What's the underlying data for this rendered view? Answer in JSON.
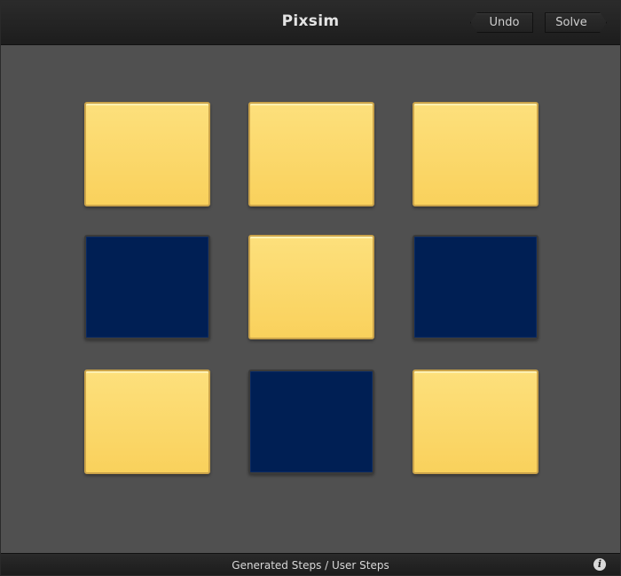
{
  "app": {
    "title": "Pixsim"
  },
  "toolbar": {
    "undo_label": "Undo",
    "solve_label": "Solve"
  },
  "board": {
    "rows": 3,
    "cols": 3,
    "colors": {
      "on": "#fbd86a",
      "off": "#001f54"
    },
    "tiles": [
      [
        "on",
        "on",
        "on"
      ],
      [
        "off",
        "on",
        "off"
      ],
      [
        "on",
        "off",
        "on"
      ]
    ]
  },
  "footer": {
    "status": "Generated Steps / User Steps",
    "info_icon": "info-icon",
    "info_glyph": "i"
  }
}
